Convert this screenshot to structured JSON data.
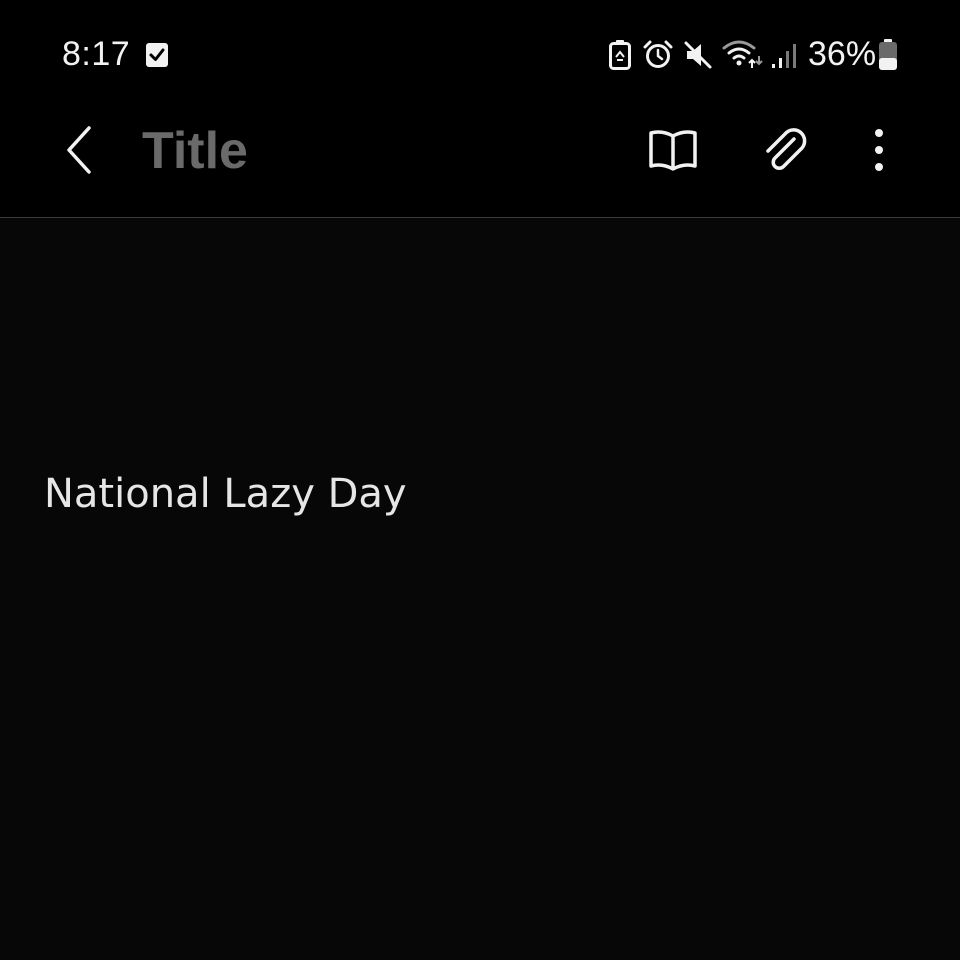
{
  "status_bar": {
    "time": "8:17",
    "battery_percent": "36%",
    "icons": [
      "checkbox-notification-icon",
      "battery-saver-icon",
      "alarm-icon",
      "mute-icon",
      "wifi-icon",
      "signal-icon",
      "battery-icon"
    ]
  },
  "toolbar": {
    "back_icon": "chevron-left-icon",
    "title_placeholder": "Title",
    "reading_mode_icon": "open-book-icon",
    "attach_icon": "paperclip-icon",
    "more_icon": "more-vertical-icon"
  },
  "note": {
    "body_text": "National Lazy Day"
  },
  "colors": {
    "background": "#000000",
    "body_background": "#070707",
    "placeholder": "#6a6a6a",
    "text": "#e6e6e6",
    "divider": "#3a3a3a"
  }
}
